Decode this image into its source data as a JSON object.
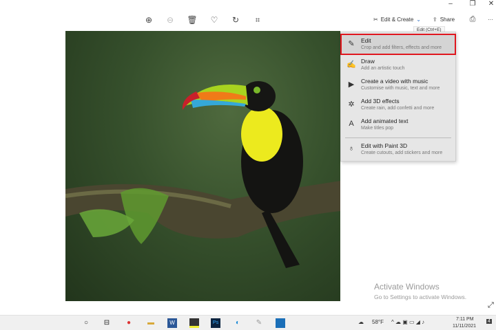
{
  "window": {
    "minimize": "–",
    "restore": "❐",
    "close": "✕"
  },
  "toolbar": {
    "edit_create": "Edit & Create",
    "share": "Share",
    "more": "···",
    "tooltip": "Edit (Ctrl+E)"
  },
  "menu": {
    "items": [
      {
        "title": "Edit",
        "subtitle": "Crop and add filters, effects and more",
        "icon": "edit-icon"
      },
      {
        "title": "Draw",
        "subtitle": "Add an artistic touch",
        "icon": "draw-icon"
      },
      {
        "title": "Create a video with music",
        "subtitle": "Customise with music, text and more",
        "icon": "video-icon"
      },
      {
        "title": "Add 3D effects",
        "subtitle": "Create rain, add confetti and more",
        "icon": "3d-effects-icon"
      },
      {
        "title": "Add animated text",
        "subtitle": "Make titles pop",
        "icon": "animated-text-icon"
      },
      {
        "title": "Edit with Paint 3D",
        "subtitle": "Create cutouts, add stickers and more",
        "icon": "paint3d-icon"
      }
    ]
  },
  "watermark": {
    "title": "Activate Windows",
    "subtitle": "Go to Settings to activate Windows."
  },
  "taskbar": {
    "weather": "58°F",
    "time": "7:11 PM",
    "date": "11/11/2021",
    "notifications": "4"
  },
  "colors": {
    "highlight": "#e0161e"
  }
}
